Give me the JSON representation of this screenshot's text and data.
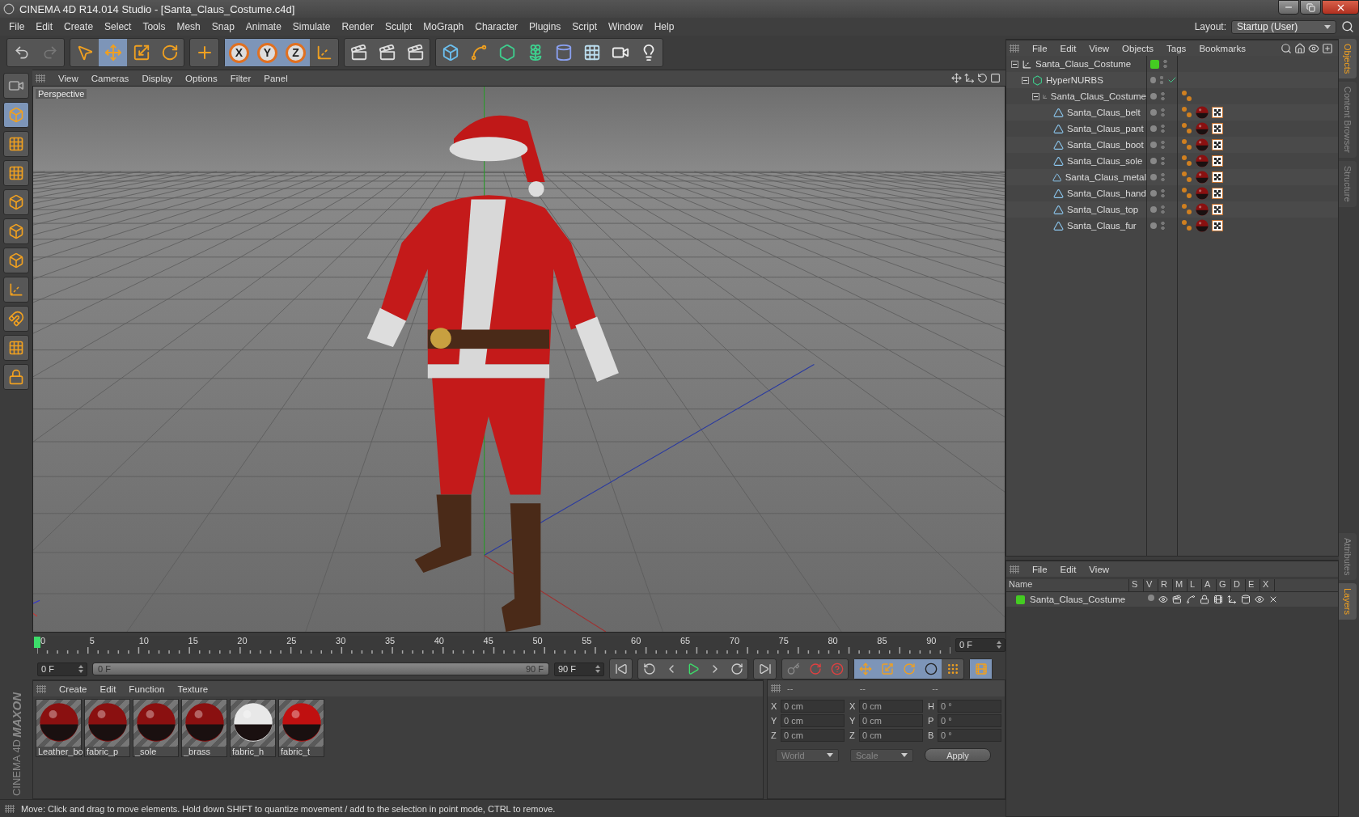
{
  "window": {
    "title": "CINEMA 4D R14.014 Studio - [Santa_Claus_Costume.c4d]"
  },
  "menu": [
    "File",
    "Edit",
    "Create",
    "Select",
    "Tools",
    "Mesh",
    "Snap",
    "Animate",
    "Simulate",
    "Render",
    "Sculpt",
    "MoGraph",
    "Character",
    "Plugins",
    "Script",
    "Window",
    "Help"
  ],
  "layout": {
    "label": "Layout:",
    "value": "Startup (User)"
  },
  "toolbar": {
    "tools": [
      {
        "kind": "select",
        "selected": false
      },
      {
        "kind": "move",
        "selected": true
      },
      {
        "kind": "scale",
        "selected": false
      },
      {
        "kind": "rotate",
        "selected": false
      }
    ],
    "axes": [
      {
        "label": "X",
        "selected": true
      },
      {
        "label": "Y",
        "selected": true
      },
      {
        "label": "Z",
        "selected": true
      }
    ]
  },
  "left_tools": [
    {
      "kind": "model",
      "selected": true
    },
    {
      "kind": "texture",
      "selected": false
    },
    {
      "kind": "workplane",
      "selected": false
    },
    {
      "kind": "points",
      "selected": false
    },
    {
      "kind": "edges",
      "selected": false
    },
    {
      "kind": "polygons",
      "selected": false
    },
    {
      "kind": "axis",
      "selected": false
    },
    {
      "kind": "magnet",
      "selected": false
    },
    {
      "kind": "grid",
      "selected": false
    },
    {
      "kind": "lock",
      "selected": false
    }
  ],
  "viewport": {
    "menu": [
      "View",
      "Cameras",
      "Display",
      "Options",
      "Filter",
      "Panel"
    ],
    "camera": "Perspective"
  },
  "timeline": {
    "ticks": [
      "0",
      "5",
      "10",
      "15",
      "20",
      "25",
      "30",
      "35",
      "40",
      "45",
      "50",
      "55",
      "60",
      "65",
      "70",
      "75",
      "80",
      "85",
      "90"
    ],
    "current_frame": "0 F",
    "start": "0 F",
    "range": {
      "start": "0 F",
      "end": "90 F",
      "level": 1
    },
    "end": "90 F"
  },
  "material_manager": {
    "menu": [
      "Create",
      "Edit",
      "Function",
      "Texture"
    ],
    "materials": [
      {
        "name": "Leather_bo",
        "color": "#8a1010"
      },
      {
        "name": "fabric_p",
        "color": "#8a1010"
      },
      {
        "name": "_sole",
        "color": "#8a1010"
      },
      {
        "name": "_brass",
        "color": "#8a1010"
      },
      {
        "name": "fabric_h",
        "color": "#e8e8e8"
      },
      {
        "name": "fabric_t",
        "color": "#c01010"
      }
    ]
  },
  "coordinates": {
    "headers": [
      "--",
      "--",
      "--"
    ],
    "columns": [
      [
        {
          "label": "X",
          "value": "0 cm"
        },
        {
          "label": "Y",
          "value": "0 cm"
        },
        {
          "label": "Z",
          "value": "0 cm"
        }
      ],
      [
        {
          "label": "X",
          "value": "0 cm"
        },
        {
          "label": "Y",
          "value": "0 cm"
        },
        {
          "label": "Z",
          "value": "0 cm"
        }
      ],
      [
        {
          "label": "H",
          "value": "0 °"
        },
        {
          "label": "P",
          "value": "0 °"
        },
        {
          "label": "B",
          "value": "0 °"
        }
      ]
    ],
    "dropdowns": [
      "World",
      "Scale"
    ],
    "apply": "Apply"
  },
  "logo": {
    "line_1": "MAXON",
    "line_2": "CINEMA 4D"
  },
  "status_bar": "Move: Click and drag to move elements. Hold down SHIFT to quantize movement / add to the selection in point mode, CTRL to remove.",
  "object_manager": {
    "menu": [
      "File",
      "Edit",
      "View",
      "Objects",
      "Tags",
      "Bookmarks"
    ],
    "tree": [
      {
        "name": "Santa_Claus_Costume",
        "kind": "null",
        "color": "#44cc22",
        "expanded": true,
        "children": [
          {
            "name": "HyperNURBS",
            "kind": "nurbs",
            "enabled": true,
            "expanded": true,
            "children": [
              {
                "name": "Santa_Claus_Costume",
                "kind": "null",
                "expanded": true,
                "tags": [
                  {
                    "kind": "phong"
                  }
                ],
                "children": [
                  {
                    "name": "Santa_Claus_belt",
                    "kind": "polygon",
                    "tags": [
                      {
                        "kind": "phong"
                      },
                      {
                        "kind": "material"
                      },
                      {
                        "kind": "texture"
                      }
                    ]
                  },
                  {
                    "name": "Santa_Claus_pant",
                    "kind": "polygon",
                    "tags": [
                      {
                        "kind": "phong"
                      },
                      {
                        "kind": "material"
                      },
                      {
                        "kind": "texture"
                      }
                    ]
                  },
                  {
                    "name": "Santa_Claus_boot",
                    "kind": "polygon",
                    "tags": [
                      {
                        "kind": "phong"
                      },
                      {
                        "kind": "material"
                      },
                      {
                        "kind": "texture"
                      }
                    ]
                  },
                  {
                    "name": "Santa_Claus_sole",
                    "kind": "polygon",
                    "tags": [
                      {
                        "kind": "phong"
                      },
                      {
                        "kind": "material"
                      },
                      {
                        "kind": "texture"
                      }
                    ]
                  },
                  {
                    "name": "Santa_Claus_metal",
                    "kind": "polygon",
                    "tags": [
                      {
                        "kind": "phong"
                      },
                      {
                        "kind": "material"
                      },
                      {
                        "kind": "texture"
                      }
                    ]
                  },
                  {
                    "name": "Santa_Claus_hand",
                    "kind": "polygon",
                    "tags": [
                      {
                        "kind": "phong"
                      },
                      {
                        "kind": "material"
                      },
                      {
                        "kind": "texture"
                      }
                    ]
                  },
                  {
                    "name": "Santa_Claus_top",
                    "kind": "polygon",
                    "tags": [
                      {
                        "kind": "phong"
                      },
                      {
                        "kind": "material"
                      },
                      {
                        "kind": "texture"
                      }
                    ]
                  },
                  {
                    "name": "Santa_Claus_fur",
                    "kind": "polygon",
                    "tags": [
                      {
                        "kind": "phong"
                      },
                      {
                        "kind": "material"
                      },
                      {
                        "kind": "texture"
                      }
                    ]
                  }
                ]
              }
            ]
          }
        ]
      }
    ]
  },
  "side_tabs_top": [
    {
      "label": "Objects",
      "selected": true
    },
    {
      "label": "Content Browser",
      "selected": false
    },
    {
      "label": "Structure",
      "selected": false
    }
  ],
  "layer_manager": {
    "menu": [
      "File",
      "Edit",
      "View"
    ],
    "columns": [
      "Name",
      "S",
      "V",
      "R",
      "M",
      "L",
      "A",
      "G",
      "D",
      "E",
      "X"
    ],
    "rows": [
      {
        "name": "Santa_Claus_Costume",
        "color": "#44cc22"
      }
    ]
  },
  "side_tabs_bottom": [
    {
      "label": "Attributes",
      "selected": false
    },
    {
      "label": "Layers",
      "selected": true
    }
  ]
}
